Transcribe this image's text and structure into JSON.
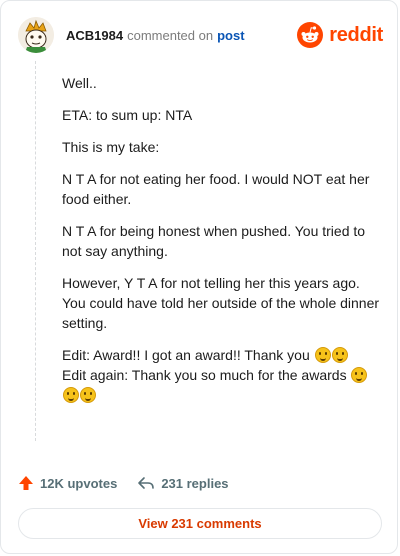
{
  "header": {
    "username": "ACB1984",
    "commented_on": "commented on",
    "post_link": "post",
    "brand": "reddit"
  },
  "comment": {
    "paragraphs": [
      "Well..",
      "ETA: to sum up: NTA",
      "This is my take:",
      "N T A for not eating her food. I would NOT eat her food either.",
      "N T A for being honest when pushed. You tried to not say anything.",
      "However, Y T A for not telling her this years ago. You could have told her outside of the whole dinner setting."
    ],
    "edit_line_1": "Edit: Award!! I got an award!! Thank you",
    "edit_line_2": "Edit again: Thank you so much for the awards"
  },
  "actions": {
    "upvotes": "12K upvotes",
    "replies": "231 replies"
  },
  "view_comments_label": "View 231 comments",
  "colors": {
    "brand": "#ff4500",
    "link": "#0a55b5",
    "action_text": "#576f76"
  }
}
